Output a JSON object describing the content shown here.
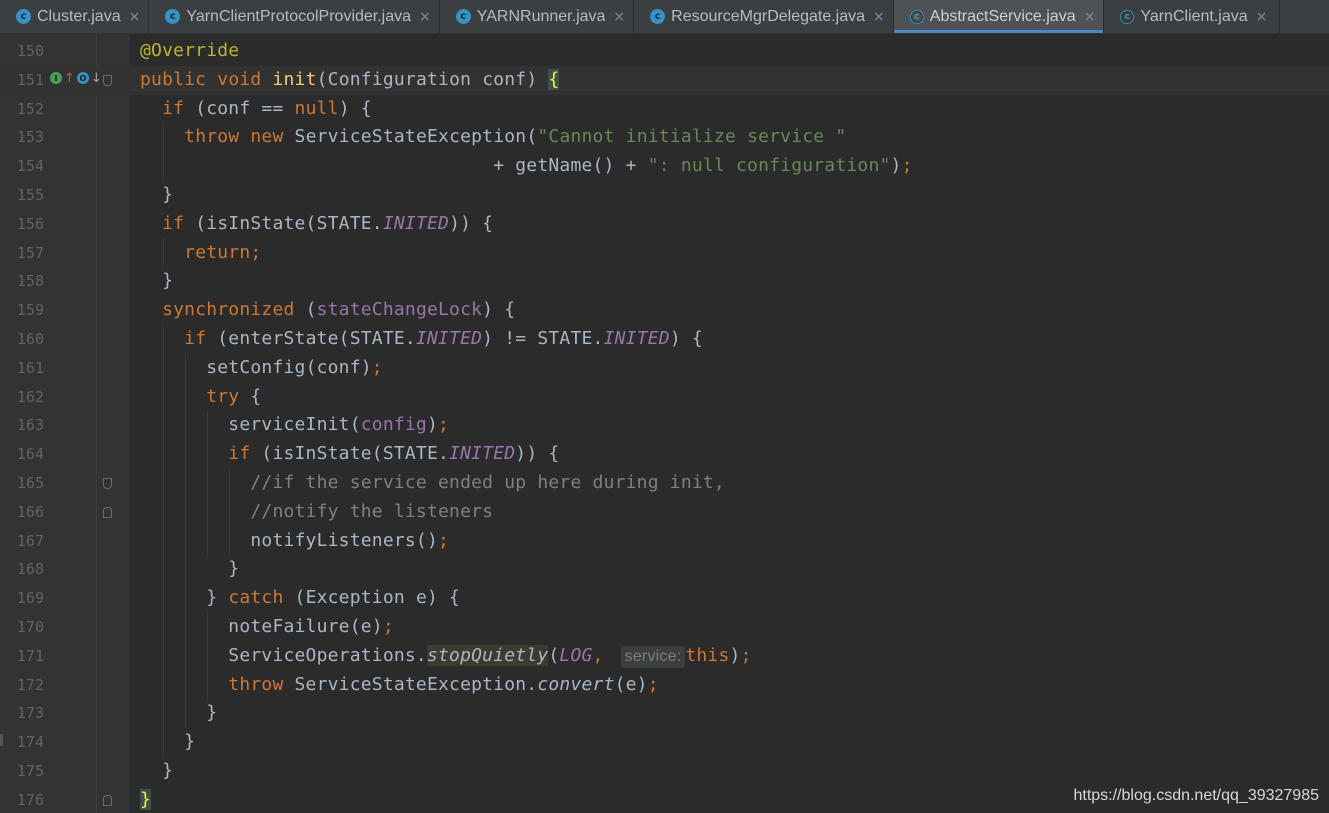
{
  "tabs": [
    {
      "label": "Cluster.java",
      "icon": "class-icon",
      "active": false
    },
    {
      "label": "YarnClientProtocolProvider.java",
      "icon": "class-icon",
      "active": false
    },
    {
      "label": "YARNRunner.java",
      "icon": "class-icon",
      "active": false
    },
    {
      "label": "ResourceMgrDelegate.java",
      "icon": "class-icon",
      "active": false
    },
    {
      "label": "AbstractService.java",
      "icon": "abstract-class-icon",
      "active": true
    },
    {
      "label": "YarnClient.java",
      "icon": "abstract-class-icon",
      "active": false
    }
  ],
  "tab_close_glyph": "×",
  "colors": {
    "keyword": "#cc7832",
    "string": "#6a8759",
    "annotation": "#bbb529",
    "field": "#9876aa",
    "method_decl": "#ffc66d",
    "comment": "#808080",
    "text": "#a9b7c6",
    "background": "#2b2b2b",
    "gutter": "#313335",
    "line_number": "#606366",
    "active_tab_underline": "#4a88c7"
  },
  "lines": [
    {
      "num": "150",
      "indent": "",
      "t": [
        [
          "@Override"
        ]
      ]
    },
    {
      "num": "151",
      "indent": "",
      "t": [
        [
          "public"
        ],
        [
          " "
        ],
        [
          "void"
        ],
        [
          " "
        ],
        [
          "init"
        ],
        [
          "(Configuration conf) "
        ],
        [
          "{"
        ]
      ]
    },
    {
      "num": "152",
      "indent": "  ",
      "t": [
        [
          "if"
        ],
        [
          " (conf == "
        ],
        [
          "null"
        ],
        [
          ") {"
        ]
      ]
    },
    {
      "num": "153",
      "indent": "    ",
      "t": [
        [
          "throw"
        ],
        [
          " "
        ],
        [
          "new"
        ],
        [
          " ServiceStateException("
        ],
        [
          "\"Cannot initialize service \""
        ]
      ]
    },
    {
      "num": "154",
      "indent": "                                ",
      "t": [
        [
          "+ getName() + "
        ],
        [
          "\": null configuration\""
        ],
        [
          ")"
        ],
        [
          ";"
        ]
      ]
    },
    {
      "num": "155",
      "indent": "  ",
      "t": [
        [
          "}"
        ]
      ]
    },
    {
      "num": "156",
      "indent": "  ",
      "t": [
        [
          "if"
        ],
        [
          " (isInState(STATE."
        ],
        [
          "INITED"
        ],
        [
          ")) {"
        ]
      ]
    },
    {
      "num": "157",
      "indent": "    ",
      "t": [
        [
          "return;"
        ]
      ]
    },
    {
      "num": "158",
      "indent": "  ",
      "t": [
        [
          "}"
        ]
      ]
    },
    {
      "num": "159",
      "indent": "  ",
      "t": [
        [
          "synchronized"
        ],
        [
          " ("
        ],
        [
          "stateChangeLock"
        ],
        [
          ") {"
        ]
      ]
    },
    {
      "num": "160",
      "indent": "    ",
      "t": [
        [
          "if"
        ],
        [
          " (enterState(STATE."
        ],
        [
          "INITED"
        ],
        [
          ") != STATE."
        ],
        [
          "INITED"
        ],
        [
          ") {"
        ]
      ]
    },
    {
      "num": "161",
      "indent": "      ",
      "t": [
        [
          "setConfig(conf)"
        ],
        [
          ";"
        ]
      ]
    },
    {
      "num": "162",
      "indent": "      ",
      "t": [
        [
          "try"
        ],
        [
          " {"
        ]
      ]
    },
    {
      "num": "163",
      "indent": "        ",
      "t": [
        [
          "serviceInit("
        ],
        [
          "config"
        ],
        [
          ")"
        ],
        [
          ";"
        ]
      ]
    },
    {
      "num": "164",
      "indent": "        ",
      "t": [
        [
          "if"
        ],
        [
          " (isInState(STATE."
        ],
        [
          "INITED"
        ],
        [
          ")) {"
        ]
      ]
    },
    {
      "num": "165",
      "indent": "          ",
      "t": [
        [
          "//if the service ended up here during init,"
        ]
      ]
    },
    {
      "num": "166",
      "indent": "          ",
      "t": [
        [
          "//notify the listeners"
        ]
      ]
    },
    {
      "num": "167",
      "indent": "          ",
      "t": [
        [
          "notifyListeners()"
        ],
        [
          ";"
        ]
      ]
    },
    {
      "num": "168",
      "indent": "        ",
      "t": [
        [
          "}"
        ]
      ]
    },
    {
      "num": "169",
      "indent": "      ",
      "t": [
        [
          "} "
        ],
        [
          "catch"
        ],
        [
          " (Exception e) {"
        ]
      ]
    },
    {
      "num": "170",
      "indent": "        ",
      "t": [
        [
          "noteFailure(e)"
        ],
        [
          ";"
        ]
      ]
    },
    {
      "num": "171",
      "indent": "        ",
      "t": [
        [
          "ServiceOperations."
        ],
        [
          "stopQuietly"
        ],
        [
          "("
        ],
        [
          "LOG"
        ],
        [
          ", "
        ],
        [
          "service:"
        ],
        [
          "this"
        ],
        [
          ")"
        ],
        [
          ";"
        ]
      ]
    },
    {
      "num": "172",
      "indent": "        ",
      "t": [
        [
          "throw"
        ],
        [
          " ServiceStateException."
        ],
        [
          "convert"
        ],
        [
          "(e)"
        ],
        [
          ";"
        ]
      ]
    },
    {
      "num": "173",
      "indent": "      ",
      "t": [
        [
          "}"
        ]
      ]
    },
    {
      "num": "174",
      "indent": "    ",
      "t": [
        [
          "}"
        ]
      ]
    },
    {
      "num": "175",
      "indent": "  ",
      "t": [
        [
          "}"
        ]
      ]
    },
    {
      "num": "176",
      "indent": "",
      "t": [
        [
          "}"
        ]
      ]
    }
  ],
  "watermark": "https://blog.csdn.net/qq_39327985"
}
